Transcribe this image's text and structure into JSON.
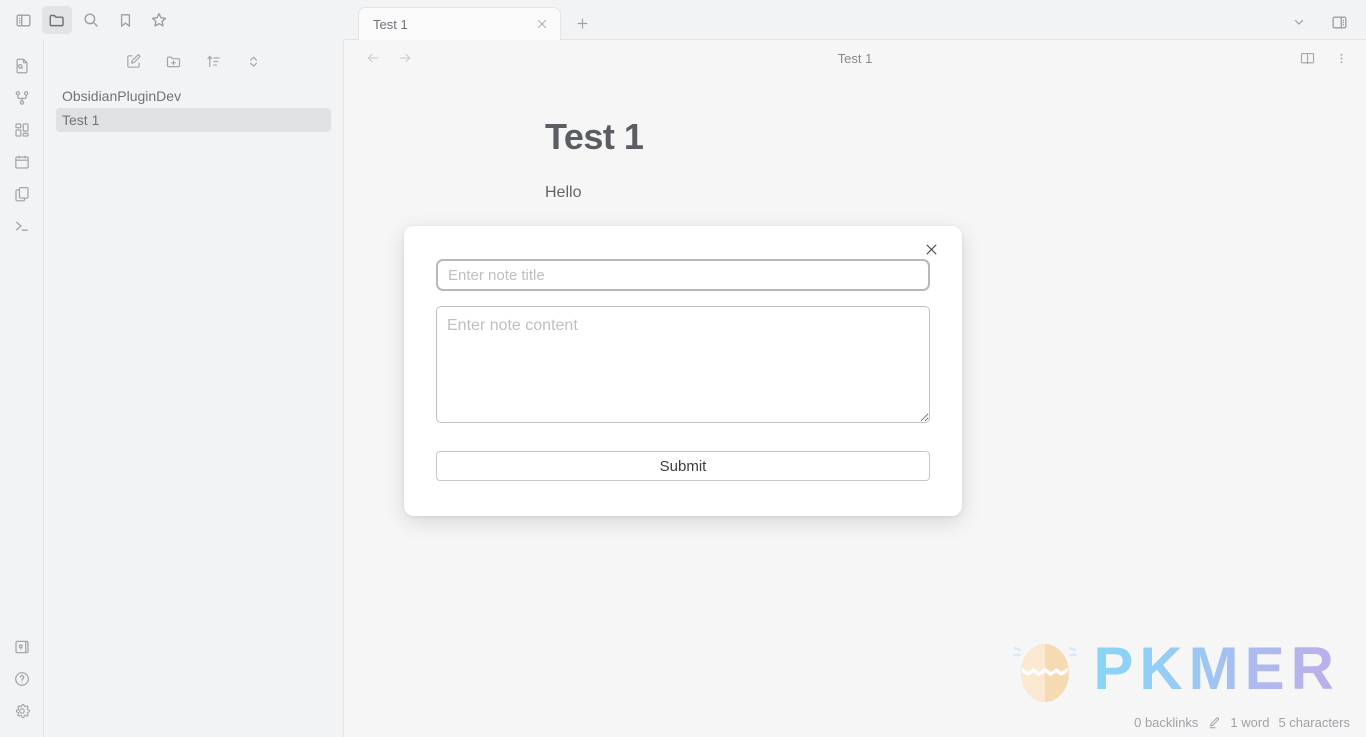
{
  "titlebar": {
    "left_icons": [
      {
        "name": "toggle-left-sidebar-icon",
        "label": "Toggle left sidebar"
      },
      {
        "name": "folder-icon",
        "label": "Files"
      },
      {
        "name": "search-icon",
        "label": "Search"
      },
      {
        "name": "bookmark-icon",
        "label": "Bookmarks"
      },
      {
        "name": "star-icon",
        "label": "Starred"
      }
    ],
    "right_icons": [
      {
        "name": "chevron-down-icon",
        "label": "More tab options"
      },
      {
        "name": "toggle-right-sidebar-icon",
        "label": "Toggle right sidebar"
      }
    ]
  },
  "tabs": [
    {
      "label": "Test 1",
      "close_label": "Close tab",
      "active": true
    }
  ],
  "new_tab": {
    "label": "New tab",
    "icon": "plus-icon"
  },
  "ribbon": {
    "top_items": [
      {
        "name": "file-search-icon",
        "label": "Quick switcher"
      },
      {
        "name": "graph-view-icon",
        "label": "Graph view"
      },
      {
        "name": "canvas-icon",
        "label": "Canvas"
      },
      {
        "name": "calendar-icon",
        "label": "Daily note"
      },
      {
        "name": "templates-icon",
        "label": "Templates"
      },
      {
        "name": "terminal-icon",
        "label": "Terminal"
      }
    ],
    "bottom_items": [
      {
        "name": "vault-icon",
        "label": "Open another vault"
      },
      {
        "name": "help-icon",
        "label": "Help"
      },
      {
        "name": "settings-icon",
        "label": "Settings"
      }
    ]
  },
  "explorer": {
    "toolbar": [
      {
        "name": "new-note-icon",
        "label": "New note"
      },
      {
        "name": "new-folder-icon",
        "label": "New folder"
      },
      {
        "name": "sort-icon",
        "label": "Change sort order"
      },
      {
        "name": "collapse-icon",
        "label": "Collapse all"
      }
    ],
    "folder": "ObsidianPluginDev",
    "files": [
      {
        "label": "Test 1",
        "selected": true
      }
    ]
  },
  "view": {
    "back_label": "Navigate back",
    "forward_label": "Navigate forward",
    "title": "Test 1",
    "actions": [
      {
        "name": "reading-mode-icon",
        "label": "Reading view"
      },
      {
        "name": "more-options-icon",
        "label": "More options"
      }
    ]
  },
  "note": {
    "title": "Test 1",
    "body": "Hello"
  },
  "watermark": {
    "text": "PKMER",
    "egg_icon": "pkmer-egg-logo"
  },
  "statusbar": {
    "backlinks": "0 backlinks",
    "edit_icon": "pencil-icon",
    "words": "1 word",
    "characters": "5 characters"
  },
  "modal": {
    "close_label": "Close",
    "title_placeholder": "Enter note title",
    "title_value": "",
    "content_placeholder": "Enter note content",
    "content_value": "",
    "submit_label": "Submit"
  },
  "colors": {
    "app_background": "#f2f3f5",
    "view_background": "#f6f6f6",
    "border": "#e4e5e7",
    "text": "#6f7378",
    "selected_item": "#e0e1e3",
    "modal_background": "#ffffff"
  }
}
